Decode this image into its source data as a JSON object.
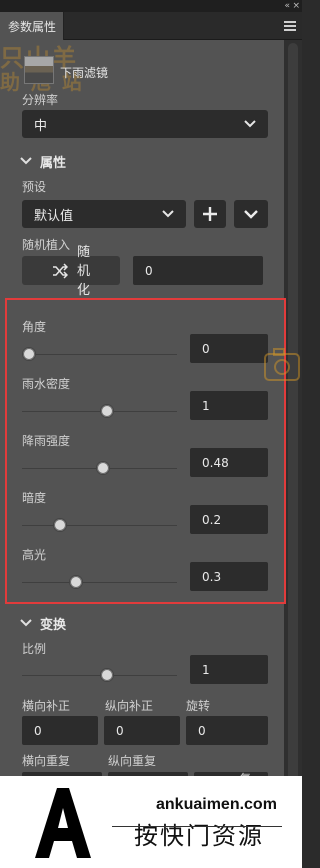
{
  "window": {
    "collapse_glyph": "«",
    "close_glyph": "×"
  },
  "tab": {
    "title": "参数属性"
  },
  "watermark": {
    "line1": "只山羊",
    "line2": "助 旭 站"
  },
  "filter": {
    "name": "下雨滤镜",
    "icon": "rain-thumbnail"
  },
  "resolution": {
    "label": "分辨率",
    "value": "中"
  },
  "properties": {
    "section_label": "属性",
    "preset_label": "预设",
    "preset_value": "默认值",
    "random_label": "随机植入",
    "random_button": "随机化",
    "random_value": "0"
  },
  "params": [
    {
      "label": "角度",
      "value": "0",
      "level": 0.0
    },
    {
      "label": "雨水密度",
      "value": "1",
      "level": 0.5
    },
    {
      "label": "降雨强度",
      "value": "0.48",
      "level": 0.48
    },
    {
      "label": "暗度",
      "value": "0.2",
      "level": 0.2
    },
    {
      "label": "高光",
      "value": "0.3",
      "level": 0.3
    }
  ],
  "transform": {
    "section_label": "变换",
    "scale_label": "比例",
    "scale_value": "1",
    "scale_level": 0.5,
    "h_offset_label": "横向补正",
    "h_offset_value": "0",
    "v_offset_label": "纵向补正",
    "v_offset_value": "0",
    "rotate_label": "旋转",
    "rotate_value": "0",
    "h_repeat_label": "横向重复",
    "v_repeat_label": "纵向重复",
    "reset_label": "复"
  },
  "brand": {
    "url": "ankuaimen.com",
    "cn": "按快门资源"
  },
  "colors": {
    "highlight_border": "#e23b3b",
    "panel_bg": "#535353",
    "field_bg": "#2c2c2c"
  }
}
